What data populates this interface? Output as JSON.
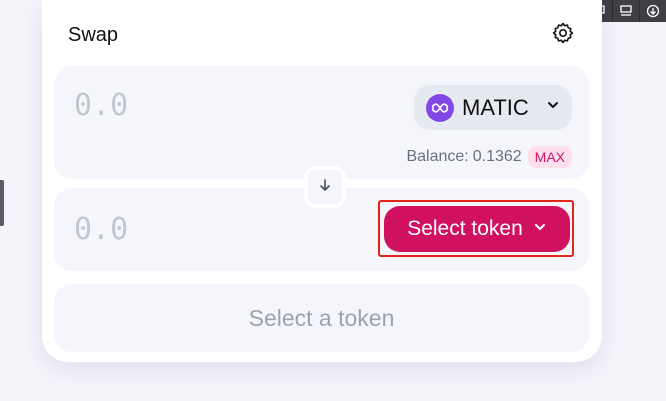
{
  "swap": {
    "title": "Swap",
    "from": {
      "amount_placeholder": "0.0",
      "token": "MATIC",
      "balance_label": "Balance:",
      "balance_value": "0.1362",
      "max_label": "MAX"
    },
    "to": {
      "amount_placeholder": "0.0",
      "select_label": "Select token"
    },
    "action_label": "Select a token"
  },
  "icons": {
    "settings": "gear-icon",
    "switch": "arrow-down-icon",
    "token_logo": "matic-logo-icon",
    "dropdown": "chevron-down-icon",
    "toolbar": [
      "comment-icon",
      "layout-icon",
      "download-icon"
    ]
  },
  "colors": {
    "accent": "#d0115f",
    "matic": "#8247e5",
    "highlight": "#e0251b"
  }
}
